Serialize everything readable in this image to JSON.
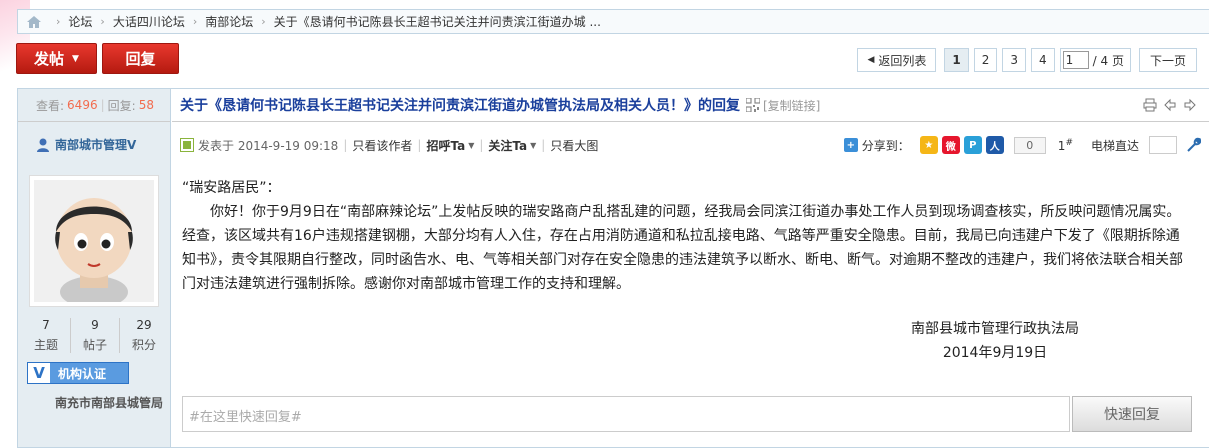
{
  "breadcrumb": {
    "items": [
      "论坛",
      "大话四川论坛",
      "南部论坛",
      "关于《恳请何书记陈县长王超书记关注并问责滨江街道办城 ..."
    ]
  },
  "actions": {
    "post_label": "发帖",
    "reply_label": "回复"
  },
  "pager": {
    "back_label": "返回列表",
    "pages": [
      "1",
      "2",
      "3",
      "4"
    ],
    "current_page": "1",
    "total_label": "/ 4 页",
    "next_label": "下一页"
  },
  "sidebar": {
    "views_label": "查看:",
    "views": "6496",
    "replies_label": "回复:",
    "replies": "58",
    "author": "南部城市管理V",
    "stats": [
      {
        "value": "7",
        "label": "主题"
      },
      {
        "value": "9",
        "label": "帖子"
      },
      {
        "value": "29",
        "label": "积分"
      }
    ],
    "verify_badge": "V",
    "verify_label": "机构认证",
    "location": "南充市南部县城管局"
  },
  "post": {
    "title": "关于《恳请何书记陈县长王超书记关注并问责滨江街道办城管执法局及相关人员！》的回复",
    "copy_link": "[复制链接]",
    "posted_at": "发表于 2014-9-19 09:18",
    "only_author": "只看该作者",
    "greet": "招呼Ta",
    "follow": "关注Ta",
    "view_large": "只看大图",
    "share_label": "分享到：",
    "share_count": "0",
    "floor": "1",
    "floor_suffix": "#",
    "jump_label": "电梯直达",
    "greeting": "“瑞安路居民”：",
    "paragraph": "你好！你于9月9日在“南部麻辣论坛”上发帖反映的瑞安路商户乱搭乱建的问题，经我局会同滨江街道办事处工作人员到现场调查核实，所反映问题情况属实。经查，该区域共有16户违规搭建钢棚，大部分均有人入住，存在占用消防通道和私拉乱接电路、气路等严重安全隐患。目前，我局已向违建户下发了《限期拆除通知书》，责令其限期自行整改，同时函告水、电、气等相关部门对存在安全隐患的违法建筑予以断水、断电、断气。对逾期不整改的违建户，我们将依法联合相关部门对违法建筑进行强制拆除。感谢你对南部城市管理工作的支持和理解。",
    "signature_org": "南部县城市管理行政执法局",
    "signature_date": "2014年9月19日"
  },
  "quick_reply": {
    "placeholder": "#在这里快速回复#",
    "button_label": "快速回复"
  },
  "colors": {
    "accent_red": "#c8221a",
    "link_blue": "#1a3f9c",
    "sidebar_bg": "#e5edf2",
    "highlight_orange": "#f26c4f"
  }
}
